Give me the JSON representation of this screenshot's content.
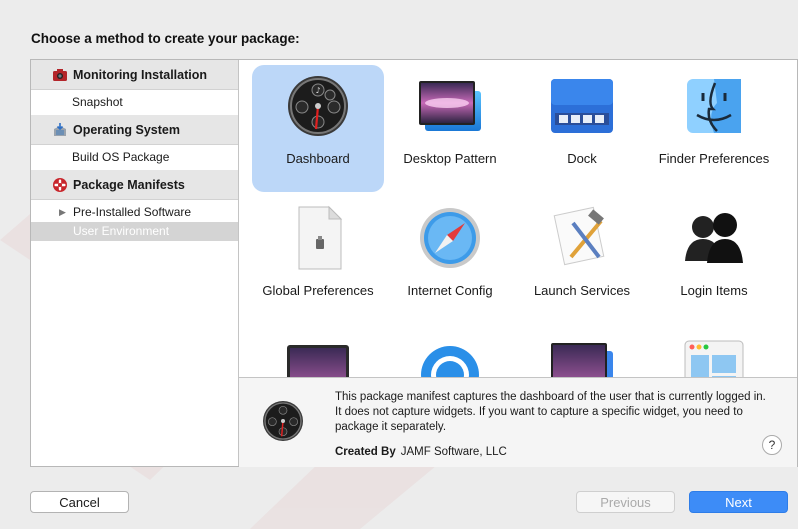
{
  "heading": "Choose a method to create your package:",
  "sidebar": {
    "sections": [
      {
        "label": "Monitoring Installation",
        "icon": "camera-icon",
        "items": [
          "Snapshot"
        ]
      },
      {
        "label": "Operating System",
        "icon": "os-installer-icon",
        "items": [
          "Build OS Package"
        ]
      },
      {
        "label": "Package Manifests",
        "icon": "manifest-badge-icon",
        "items": [
          "Pre-Installed Software",
          "User Environment"
        ]
      }
    ],
    "selected_item": "User Environment"
  },
  "grid": {
    "tiles": [
      {
        "label": "Dashboard",
        "icon": "dashboard-icon",
        "selected": true
      },
      {
        "label": "Desktop Pattern",
        "icon": "desktop-pattern-icon"
      },
      {
        "label": "Dock",
        "icon": "dock-icon"
      },
      {
        "label": "Finder Preferences",
        "icon": "finder-icon"
      },
      {
        "label": "Global Preferences",
        "icon": "global-preferences-icon"
      },
      {
        "label": "Internet Config",
        "icon": "safari-icon"
      },
      {
        "label": "Launch Services",
        "icon": "launch-services-icon"
      },
      {
        "label": "Login Items",
        "icon": "login-items-icon"
      },
      {
        "label": "",
        "icon": "screen-saver-icon"
      },
      {
        "label": "",
        "icon": "quicktime-icon"
      },
      {
        "label": "",
        "icon": "desktop-icon"
      },
      {
        "label": "",
        "icon": "window-icon"
      }
    ]
  },
  "description": {
    "text": "This package manifest captures the dashboard of the user that is currently logged in. It does not capture widgets. If you want to capture a specific widget, you need to package it separately.",
    "created_by_label": "Created By",
    "created_by_value": "JAMF Software, LLC",
    "help_label": "?"
  },
  "buttons": {
    "cancel": "Cancel",
    "previous": "Previous",
    "next": "Next"
  },
  "colors": {
    "accent": "#3d8cf7",
    "selection": "#bcd7f8",
    "watermark": "#c8262c"
  }
}
